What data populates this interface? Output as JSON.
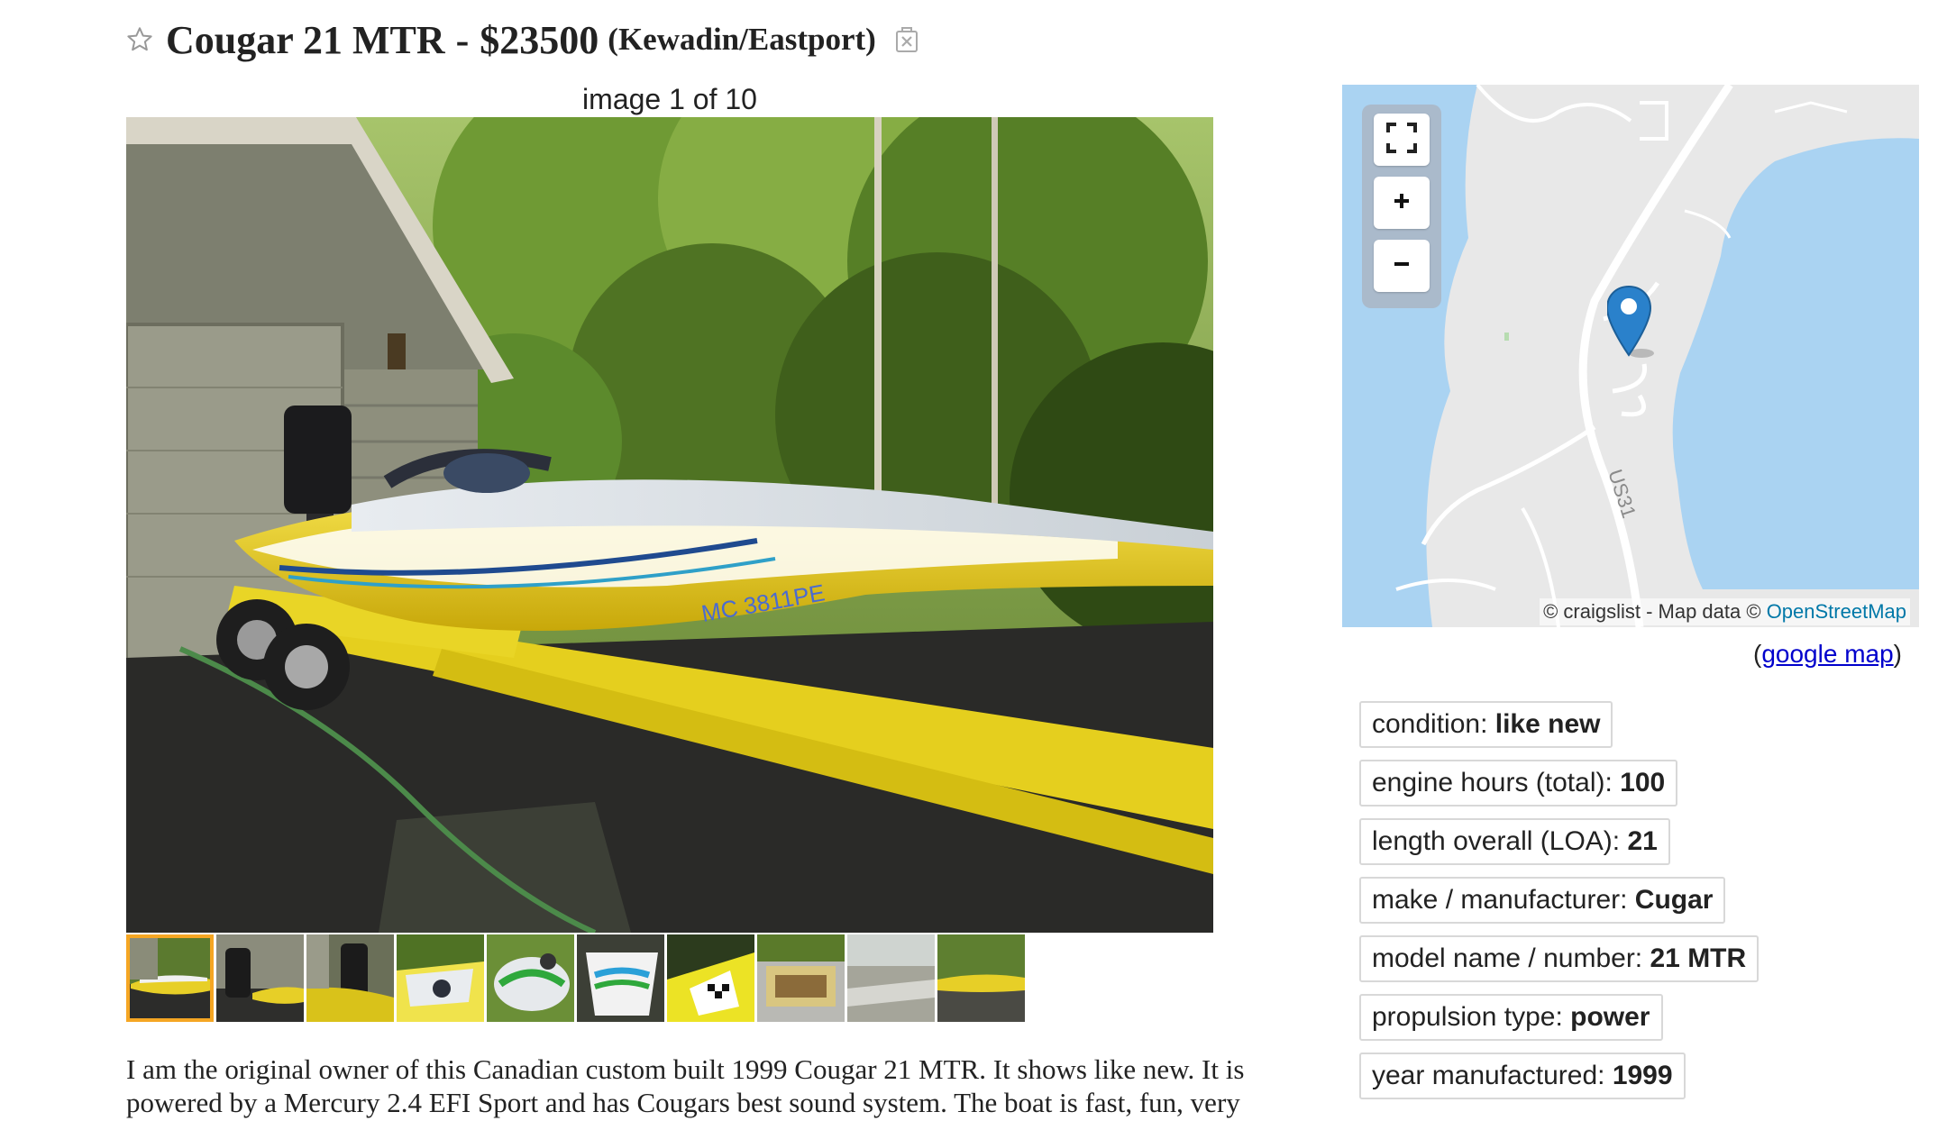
{
  "title": {
    "name": "Cougar 21 MTR",
    "separator": "-",
    "price": "$23500",
    "location": "(Kewadin/Eastport)",
    "star_icon": "star-outline-icon",
    "hide_icon": "hide-posting-icon"
  },
  "gallery": {
    "counter": "image 1 of 10",
    "total": 10,
    "selected_index": 1,
    "accent": "#f5a623"
  },
  "map": {
    "controls": [
      {
        "icon": "fullscreen-icon"
      },
      {
        "icon": "zoom-in-icon",
        "glyph": "+"
      },
      {
        "icon": "zoom-out-icon",
        "glyph": "−"
      }
    ],
    "road_label": "US31",
    "attribution_prefix": "© craigslist - Map data © ",
    "attribution_link": "OpenStreetMap",
    "google_map_open": "(",
    "google_map_link": "google map",
    "google_map_close": ")",
    "water_color": "#aad3f2",
    "land_color": "#e8e8e8",
    "pin_color": "#2a81cb"
  },
  "attributes": [
    {
      "label": "condition: ",
      "value": "like new"
    },
    {
      "label": "engine hours (total): ",
      "value": "100"
    },
    {
      "label": "length overall (LOA): ",
      "value": "21"
    },
    {
      "label": "make / manufacturer: ",
      "value": "Cugar"
    },
    {
      "label": "model name / number: ",
      "value": "21 MTR"
    },
    {
      "label": "propulsion type: ",
      "value": "power"
    },
    {
      "label": "year manufactured: ",
      "value": "1999"
    }
  ],
  "body": {
    "line1": "I am the original owner of this Canadian custom built 1999 Cougar 21 MTR. It shows like new. It is",
    "line2": "powered by a Mercury 2.4 EFI Sport and has Cougars best sound system. The boat is fast, fun, very"
  }
}
